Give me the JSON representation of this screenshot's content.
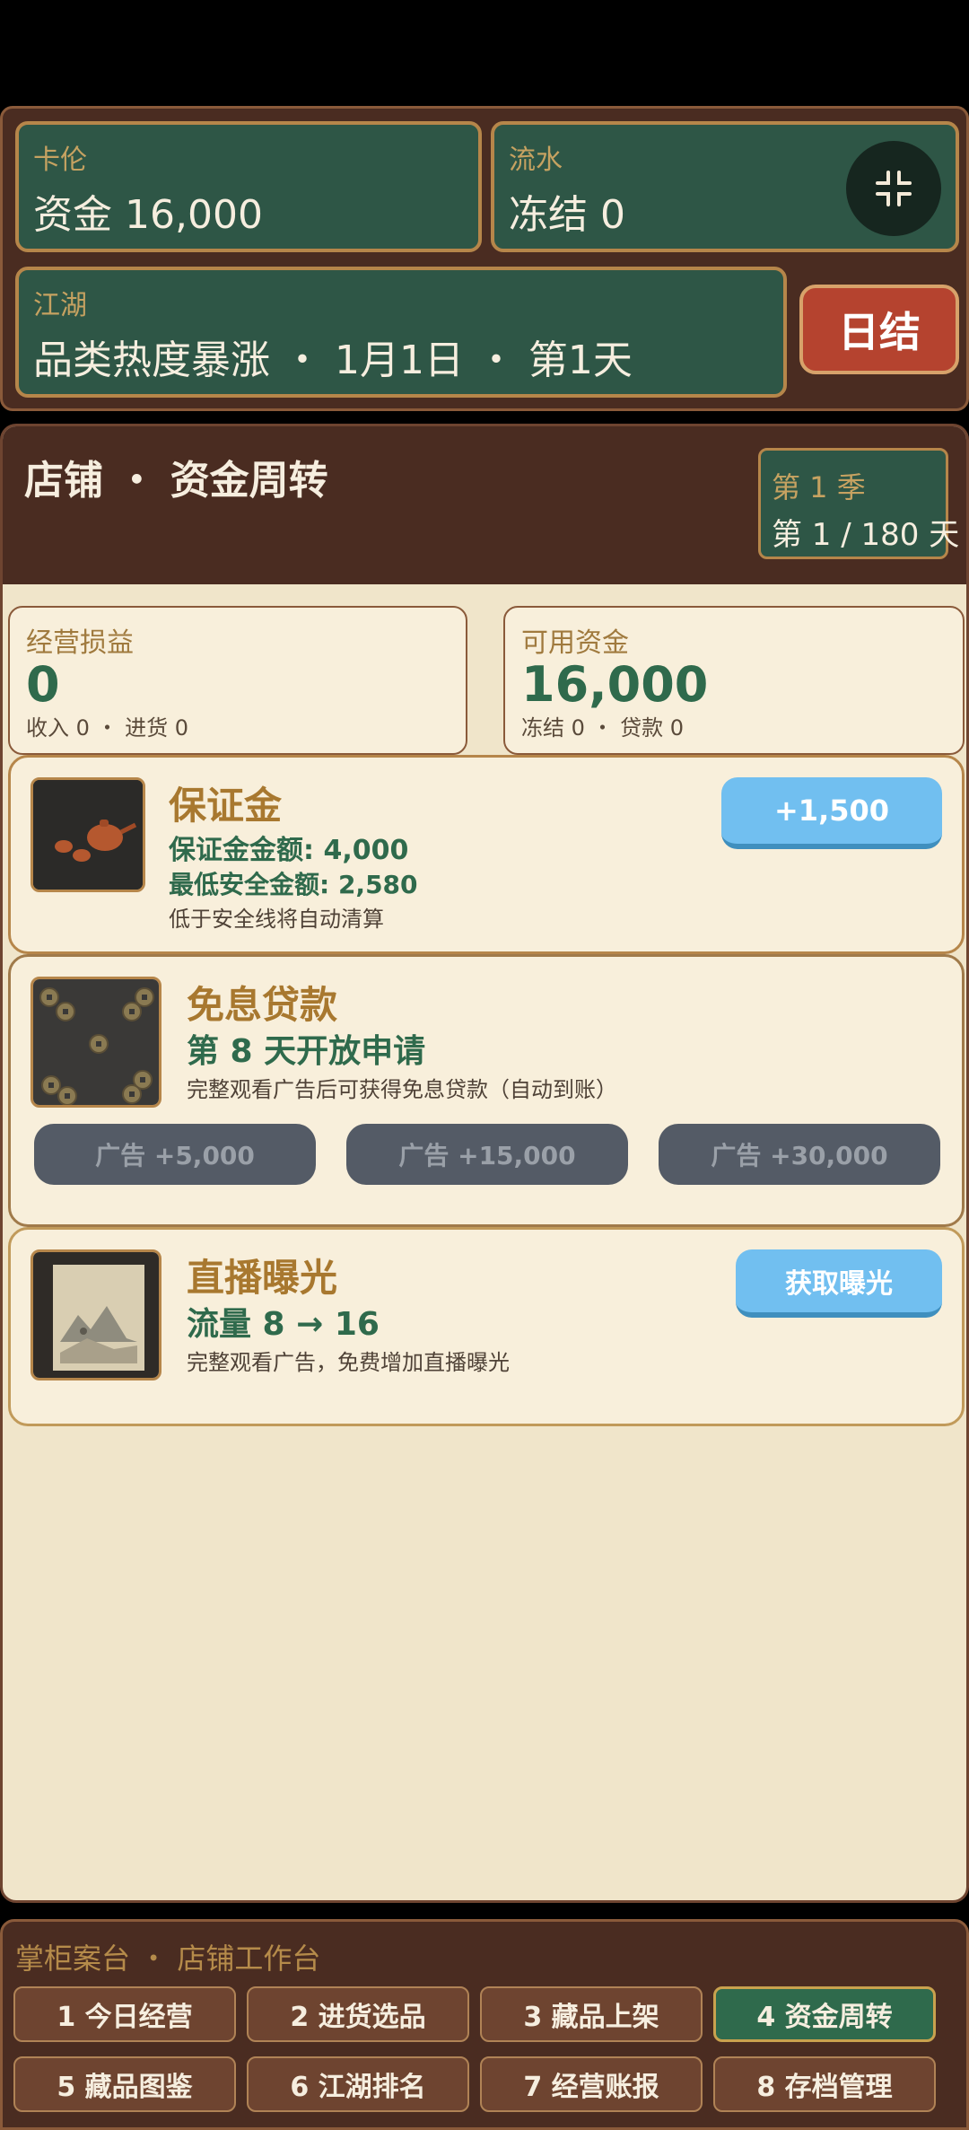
{
  "hud": {
    "name_label": "卡伦",
    "funds_text": "资金 16,000",
    "flow_label": "流水",
    "frozen_text": "冻结 0",
    "world_label": "江湖",
    "world_text": "品类热度暴涨 ・ 1月1日 ・ 第1天",
    "settle_label": "日结",
    "fullscreen_icon": "collapse-icon"
  },
  "main": {
    "title": "店铺 ・ 资金周转",
    "season_label": "第 1 季",
    "day_label": "第 1 / 180 天"
  },
  "stats": {
    "pnl_label": "经营损益",
    "pnl_value": "0",
    "pnl_sub": "收入 0 ・ 进货 0",
    "funds_label": "可用资金",
    "funds_value": "16,000",
    "funds_sub": "冻结 0 ・ 贷款 0"
  },
  "deposit": {
    "title": "保证金",
    "amount": "保证金金额: 4,000",
    "min_safe": "最低安全金额: 2,580",
    "note": "低于安全线将自动清算",
    "button": "+1,500"
  },
  "loan": {
    "title": "免息贷款",
    "status": "第 8 天开放申请",
    "note": "完整观看广告后可获得免息贷款（自动到账）",
    "ads": [
      "广告 +5,000",
      "广告 +15,000",
      "广告 +30,000"
    ]
  },
  "live": {
    "title": "直播曝光",
    "traffic": "流量 8 → 16",
    "note": "完整观看广告，免费增加直播曝光",
    "button": "获取曝光"
  },
  "nav": {
    "title": "掌柜案台 ・ 店铺工作台",
    "items": [
      "1 今日经营",
      "2 进货选品",
      "3 藏品上架",
      "4 资金周转",
      "5 藏品图鉴",
      "6 江湖排名",
      "7 经营账报",
      "8 存档管理"
    ],
    "active_index": 3
  },
  "colors": {
    "panel_brown": "#4a2c21",
    "hud_green": "#2e5646",
    "gold_border": "#b6864a",
    "settle_red": "#b5432f",
    "action_blue": "#71bff0",
    "value_green": "#2f6a4c",
    "parchment": "#f0e5ca"
  }
}
